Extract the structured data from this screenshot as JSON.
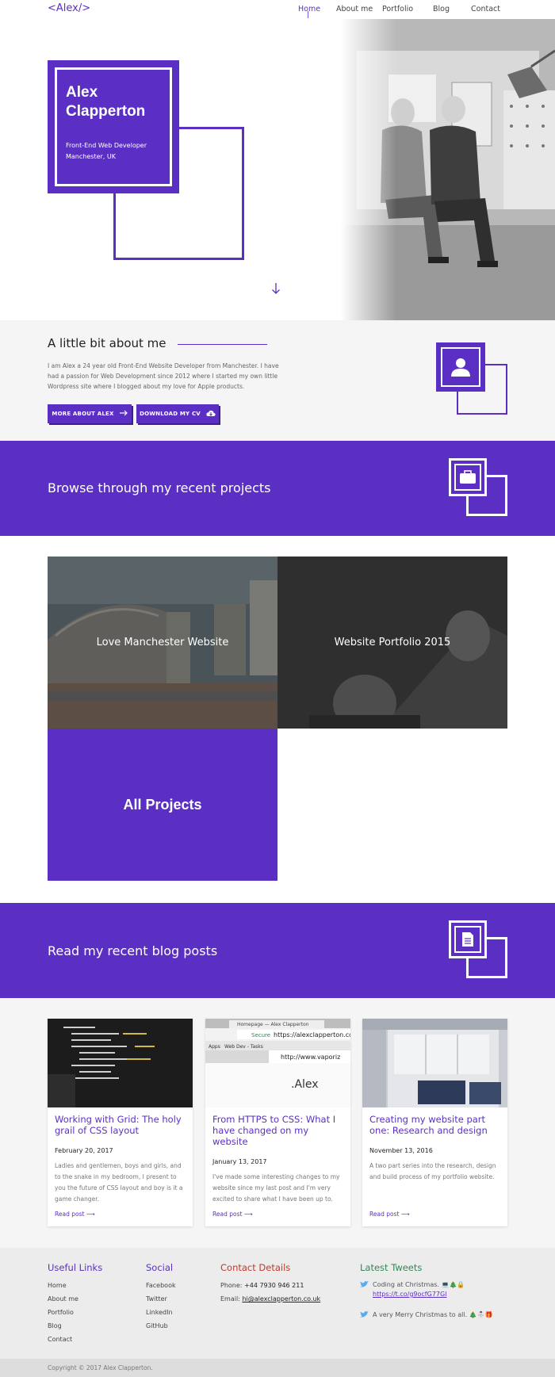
{
  "header": {
    "logo": "<Alex/>",
    "nav": [
      {
        "label": "Home",
        "active": true
      },
      {
        "label": "About me"
      },
      {
        "label": "Portfolio"
      },
      {
        "label": "Blog"
      },
      {
        "label": "Contact"
      }
    ]
  },
  "hero": {
    "name": "Alex Clapperton",
    "role_line1": "Front-End Web Developer",
    "role_line2": "Manchester, UK",
    "scroll_icon": "arrow-down-icon"
  },
  "about": {
    "title": "A little bit about me",
    "text": "I am Alex a 24 year old Front-End Website Developer from Manchester. I have had a passion for Web Development since 2012 where I started my own little Wordpress site where I blogged about my love for Apple products.",
    "more_button": "MORE ABOUT ALEX",
    "cv_button": "DOWNLOAD MY CV",
    "icon": "user-icon"
  },
  "projects": {
    "banner_title": "Browse through my recent projects",
    "banner_icon": "briefcase-icon",
    "items": [
      {
        "label": "Love Manchester Website"
      },
      {
        "label": "Website Portfolio 2015"
      }
    ],
    "all_label": "All Projects"
  },
  "blog": {
    "banner_title": "Read my recent blog posts",
    "banner_icon": "document-icon",
    "posts": [
      {
        "title": "Working with Grid: The holy grail of CSS layout",
        "date": "February 20, 2017",
        "excerpt": "Ladies and gentlemen, boys and girls, and to the snake in my bedroom, I present to you the future of CSS layout and boy is it a game changer.",
        "link": "Read post"
      },
      {
        "title": "From HTTPS to CSS: What I have changed on my website",
        "date": "January 13, 2017",
        "excerpt": "I've made some interesting changes to my website since my last post and I'm very excited to share what I have been up to.",
        "link": "Read post",
        "browser_tab": "Homepage — Alex Clapperton",
        "browser_secure": "Secure",
        "browser_url": "https://alexclapperton.co",
        "browser_apps": "Apps",
        "browser_bookmark": "Web Dev - Tasks",
        "browser_url2": "http://www.vaporiz",
        "browser_page": ".Alex"
      },
      {
        "title": "Creating my website part one: Research and design",
        "date": "November 13, 2016",
        "excerpt": "A two part series into the research, design and build process of my portfolio website.",
        "link": "Read post"
      }
    ]
  },
  "footer": {
    "useful_title": "Useful Links",
    "useful_links": [
      "Home",
      "About me",
      "Portfolio",
      "Blog",
      "Contact"
    ],
    "social_title": "Social",
    "social_links": [
      "Facebook",
      "Twitter",
      "LinkedIn",
      "GitHub"
    ],
    "contact_title": "Contact Details",
    "phone_label": "Phone:",
    "phone": "+44 7930 946 211",
    "email_label": "Email:",
    "email": "hi@alexclapperton.co.uk",
    "tweets_title": "Latest Tweets",
    "tweet1": "Coding at Christmas. 💻🎄🔒",
    "tweet1_link": "https://t.co/g9ocfG77Gl",
    "tweet2": "A very Merry Christmas to all. 🎄⛄🎁",
    "copyright": "Copyright © 2017 Alex Clapperton.",
    "colors": {
      "useful": "#5b2fc4",
      "social": "#5b2fc4",
      "contact": "#c0392b",
      "tweets": "#2e8b57",
      "twitter": "#55acee"
    }
  },
  "colors": {
    "accent": "#5b2fc4",
    "light_bg": "#f5f5f5",
    "footer_bg": "#ececec"
  }
}
